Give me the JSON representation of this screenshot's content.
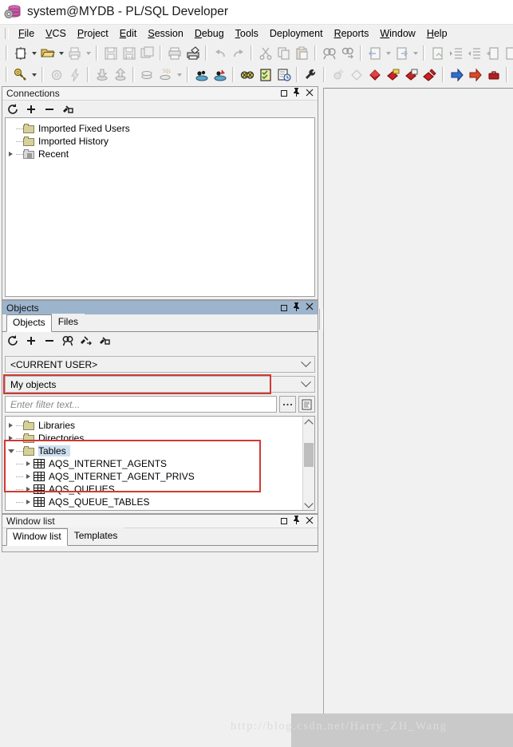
{
  "window": {
    "title": "system@MYDB - PL/SQL Developer",
    "app_icon": "database-icon"
  },
  "menubar": {
    "items": [
      {
        "label": "File",
        "mnemonic": "F"
      },
      {
        "label": "VCS",
        "mnemonic": "V"
      },
      {
        "label": "Project",
        "mnemonic": "P"
      },
      {
        "label": "Edit",
        "mnemonic": "E"
      },
      {
        "label": "Session",
        "mnemonic": "S"
      },
      {
        "label": "Debug",
        "mnemonic": "D"
      },
      {
        "label": "Tools",
        "mnemonic": "T"
      },
      {
        "label": "Deployment",
        "mnemonic": ""
      },
      {
        "label": "Reports",
        "mnemonic": "R"
      },
      {
        "label": "Window",
        "mnemonic": "W"
      },
      {
        "label": "Help",
        "mnemonic": "H"
      }
    ]
  },
  "toolbar_row1": {
    "icons": [
      "new-program-window-icon",
      "open-folder-icon",
      "print-preview-icon",
      "save-icon",
      "save-all-icon",
      "save-as-icon",
      "print-icon",
      "print-setup-icon",
      "undo-icon",
      "redo-icon",
      "cut-icon",
      "copy-icon",
      "paste-icon",
      "find-icon",
      "find-next-icon",
      "previous-window-icon",
      "next-window-icon",
      "execute-icon",
      "indent-icon",
      "outdent-icon",
      "comment-icon",
      "uncomment-icon",
      "new-sheet-icon"
    ]
  },
  "toolbar_row2": {
    "icons": [
      "session-key-icon",
      "gear-icon",
      "lightning-icon",
      "import-table-icon",
      "export-table-icon",
      "commit-icon",
      "rollback-sql-icon",
      "begin-session-icon",
      "rollback-icon",
      "test-window-icon",
      "task-list-icon",
      "report-icon",
      "wrench-icon",
      "breakpoint-add-icon",
      "breakpoint-clear-icon",
      "breakpoint-icon",
      "breakpoint-conditional-icon",
      "breakpoint-toggle-icon",
      "breakpoint-set-icon",
      "step-into-icon",
      "step-over-icon",
      "stop-debug-icon",
      "export-window-icon",
      "import-window-icon"
    ]
  },
  "connections_panel": {
    "title": "Connections",
    "active": false,
    "window_buttons": [
      "maximize",
      "pin",
      "close"
    ],
    "toolbar_icons": [
      "refresh-icon",
      "add-icon",
      "remove-icon",
      "configure-icon"
    ],
    "tree": [
      {
        "label": "Imported Fixed Users",
        "icon": "folder-icon",
        "expandable": false,
        "indent": 1
      },
      {
        "label": "Imported History",
        "icon": "folder-icon",
        "expandable": false,
        "indent": 1
      },
      {
        "label": "Recent",
        "icon": "folder-gray-icon",
        "expandable": true,
        "indent": 1
      }
    ]
  },
  "objects_panel": {
    "title": "Objects",
    "active": true,
    "window_buttons": [
      "maximize",
      "pin",
      "close"
    ],
    "tabs": [
      {
        "label": "Objects",
        "active": true
      },
      {
        "label": "Files",
        "active": false
      }
    ],
    "toolbar_icons": [
      "refresh-icon",
      "add-icon",
      "remove-icon",
      "find-icon",
      "filter-icon",
      "configure-icon"
    ],
    "user_combo": {
      "value": "<CURRENT USER>"
    },
    "scope_combo": {
      "value": "My objects",
      "highlighted": true
    },
    "filter_input": {
      "value": "",
      "placeholder": "Enter filter text..."
    },
    "filter_buttons": [
      "ellipsis-button",
      "filter-report-icon"
    ],
    "tree": [
      {
        "label": "Libraries",
        "icon": "folder-icon",
        "expandable": true,
        "indent": 0,
        "selected": false
      },
      {
        "label": "Directories",
        "icon": "folder-icon",
        "expandable": true,
        "indent": 0,
        "selected": false
      },
      {
        "label": "Tables",
        "icon": "folder-open-icon",
        "expandable": true,
        "expanded": true,
        "indent": 0,
        "selected": true
      },
      {
        "label": "AQS_INTERNET_AGENTS",
        "icon": "table-icon",
        "expandable": true,
        "indent": 1,
        "selected": false
      },
      {
        "label": "AQS_INTERNET_AGENT_PRIVS",
        "icon": "table-icon",
        "expandable": true,
        "indent": 1,
        "selected": false
      },
      {
        "label": "AQS_QUEUES",
        "icon": "table-icon",
        "expandable": true,
        "indent": 1,
        "selected": false
      },
      {
        "label": "AQS_QUEUE_TABLES",
        "icon": "table-icon",
        "expandable": true,
        "indent": 1,
        "selected": false
      }
    ]
  },
  "windowlist_panel": {
    "title": "Window list",
    "active": false,
    "window_buttons": [
      "maximize",
      "pin",
      "close"
    ],
    "tabs": [
      {
        "label": "Window list",
        "active": true
      },
      {
        "label": "Templates",
        "active": false
      }
    ]
  },
  "annotations": {
    "highlight_color": "#cf3a34",
    "boxes": [
      "scope-combo-highlight",
      "tables-tree-highlight"
    ]
  },
  "watermark": {
    "text": "http://blog.csdn.net/Harry_ZH_Wang"
  }
}
